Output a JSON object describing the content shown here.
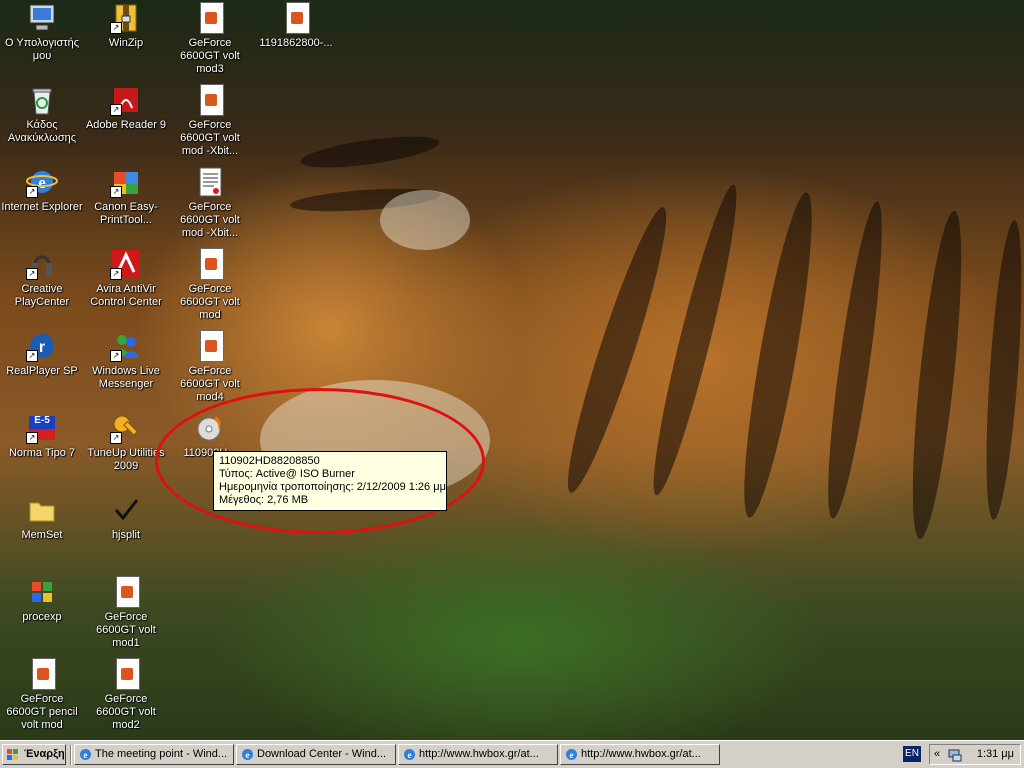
{
  "desktop": {
    "icons": [
      {
        "label": "Ο Υπολογιστής μου"
      },
      {
        "label": "Κάδος Ανακύκλωσης"
      },
      {
        "label": "Internet Explorer"
      },
      {
        "label": "Creative PlayCenter"
      },
      {
        "label": "RealPlayer SP"
      },
      {
        "label": "Norma Tipo 7"
      },
      {
        "label": "MemSet"
      },
      {
        "label": "procexp"
      },
      {
        "label": "GeForce 6600GT pencil volt mod"
      },
      {
        "label": "WinZip"
      },
      {
        "label": "Adobe Reader 9"
      },
      {
        "label": "Canon Easy-PrintTool..."
      },
      {
        "label": "Avira AntiVir Control Center"
      },
      {
        "label": "Windows Live Messenger"
      },
      {
        "label": "TuneUp Utilities 2009"
      },
      {
        "label": "hjsplit"
      },
      {
        "label": "GeForce 6600GT volt mod1"
      },
      {
        "label": "GeForce 6600GT volt mod2"
      },
      {
        "label": "GeForce 6600GT volt mod3"
      },
      {
        "label": "GeForce 6600GT volt mod -Xbit..."
      },
      {
        "label": "GeForce 6600GT volt mod -Xbit..."
      },
      {
        "label": "GeForce 6600GT volt mod"
      },
      {
        "label": "GeForce 6600GT volt mod4"
      },
      {
        "label": "110902H..."
      },
      {
        "label": "1191862800-..."
      }
    ],
    "norma_badge": "E-5"
  },
  "tooltip": {
    "name": "110902HD88208850",
    "type": "Τύπος: Active@ ISO Burner",
    "modified": "Ημερομηνία τροποποίησης: 2/12/2009 1:26 μμ",
    "size": "Μέγεθος: 2,76 MB"
  },
  "taskbar": {
    "start_label": "Έναρξη",
    "tasks": [
      {
        "label": "The meeting point - Wind..."
      },
      {
        "label": "Download Center - Wind..."
      },
      {
        "label": "http://www.hwbox.gr/at..."
      },
      {
        "label": "http://www.hwbox.gr/at..."
      }
    ],
    "language": "EN",
    "tray_chevron": "«",
    "clock": "1:31 μμ"
  },
  "colors": {
    "tooltip_bg": "#ffffe1",
    "taskbar_bg": "#d4d0c8",
    "highlight_circle": "#e01010"
  }
}
